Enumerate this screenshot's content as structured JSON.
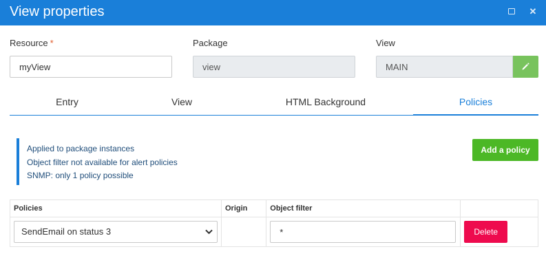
{
  "window": {
    "title": "View properties",
    "maximize_icon": "maximize-icon",
    "close_icon": "close-icon",
    "close_glyph": "✕"
  },
  "fields": {
    "resource": {
      "label": "Resource",
      "required_mark": "*",
      "value": "myView"
    },
    "package": {
      "label": "Package",
      "value": "view"
    },
    "view": {
      "label": "View",
      "value": "MAIN",
      "edit_icon": "pencil-icon"
    }
  },
  "tabs": [
    {
      "label": "Entry"
    },
    {
      "label": "View"
    },
    {
      "label": "HTML Background"
    },
    {
      "label": "Policies",
      "active": true
    }
  ],
  "info": {
    "lines": [
      "Applied to package instances",
      "Object filter not available for alert policies",
      "SNMP: only 1 policy possible"
    ]
  },
  "actions": {
    "add_policy_label": "Add a policy"
  },
  "table": {
    "headers": {
      "policies": "Policies",
      "origin": "Origin",
      "object_filter": "Object filter"
    },
    "rows": [
      {
        "policy": "SendEmail on status 3",
        "origin": "",
        "object_filter": "*",
        "delete_label": "Delete"
      }
    ]
  },
  "colors": {
    "titlebar": "#1a7fd9",
    "accent": "#1a7fd9",
    "edit_button": "#78c35d",
    "add_button": "#4cb826",
    "delete_button": "#ee0b4e",
    "required": "#e05a2a"
  }
}
